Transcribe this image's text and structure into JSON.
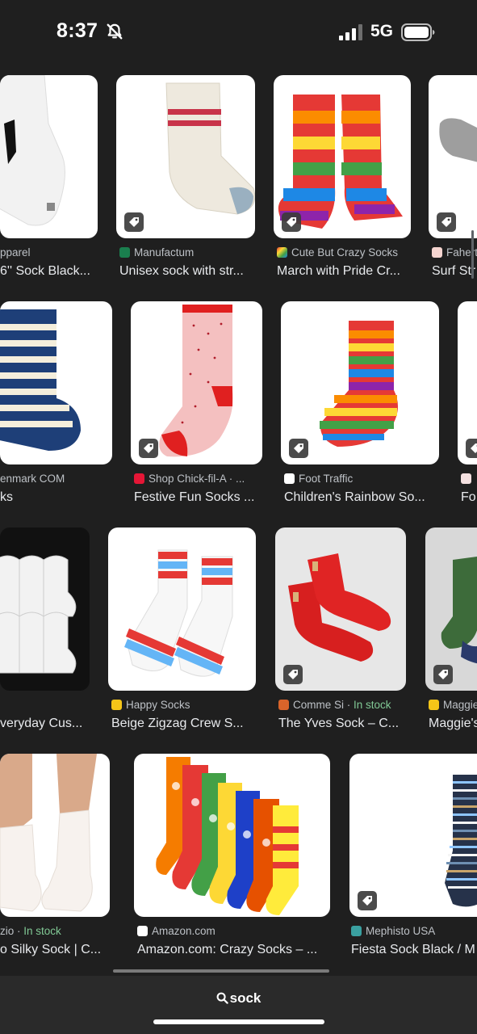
{
  "status": {
    "time": "8:37",
    "network": "5G"
  },
  "rows": [
    [
      {
        "source": "pparel",
        "title": "6'' Sock Black..."
      },
      {
        "source": "Manufactum",
        "title": "Unisex sock with str..."
      },
      {
        "source": "Cute But Crazy Socks",
        "title": "March with Pride Cr..."
      },
      {
        "source": "Fahert",
        "title": "Surf Str"
      }
    ],
    [
      {
        "source": "enmark COM",
        "title": "ks"
      },
      {
        "source": "Shop Chick-fil-A · ...",
        "title": "Festive Fun Socks ..."
      },
      {
        "source": "Foot Traffic",
        "title": "Children's Rainbow So..."
      },
      {
        "source": "",
        "title": "Fo"
      }
    ],
    [
      {
        "source": "",
        "title": "veryday Cus..."
      },
      {
        "source": "Happy Socks",
        "title": "Beige Zigzag Crew S..."
      },
      {
        "source": "Comme Si",
        "stock": "In stock",
        "title": "The Yves Sock – C..."
      },
      {
        "source": "Maggie",
        "title": "Maggie's"
      }
    ],
    [
      {
        "source": "zio",
        "stock": "In stock",
        "title": "o Silky Sock | C..."
      },
      {
        "source": "Amazon.com",
        "title": "Amazon.com: Crazy Socks – ..."
      },
      {
        "source": "Mephisto USA",
        "title": "Fiesta Sock Black / M"
      }
    ]
  ],
  "search": {
    "query": "sock"
  },
  "icons": {
    "tag": "price-tag-icon",
    "bell": "bell-slash-icon",
    "search": "search-icon",
    "signal": "signal-bars-icon",
    "battery": "battery-icon"
  },
  "colors": {
    "background": "#1f1f1f",
    "text": "#e8eaed",
    "secondary": "#bdc1c6",
    "in_stock": "#81c995"
  }
}
